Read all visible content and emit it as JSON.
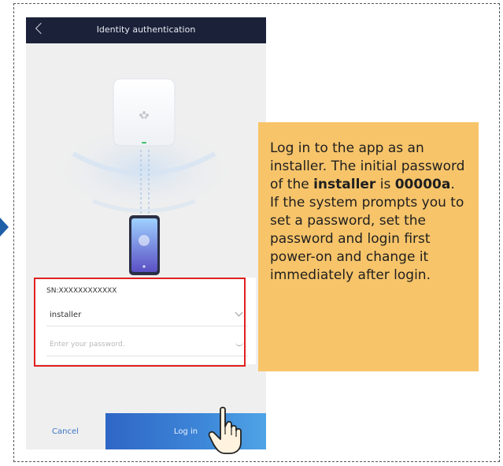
{
  "app": {
    "title": "Identity authentication"
  },
  "form": {
    "sn_label": "SN:XXXXXXXXXXXX",
    "username_value": "installer",
    "password_placeholder": "Enter your password."
  },
  "actions": {
    "cancel_label": "Cancel",
    "login_label": "Log in"
  },
  "note": {
    "part1": "Log in to the app as an installer. The initial password of the ",
    "bold_user": "installer",
    "part2": " is ",
    "bold_password": "00000a",
    "part3": ". If the system prompts you to set a password, set the password and login first power-on and change it immediately after login."
  },
  "colors": {
    "header_bg": "#1a2138",
    "login_button": "#3d86d8",
    "highlight_border": "#e02020",
    "note_bg": "#f7c46a",
    "pointer_arrow": "#1f5fa8"
  },
  "icons": [
    "back-chevron-icon",
    "huawei-logo-icon",
    "chevron-down-icon",
    "eye-closed-icon",
    "pointing-hand-icon"
  ]
}
